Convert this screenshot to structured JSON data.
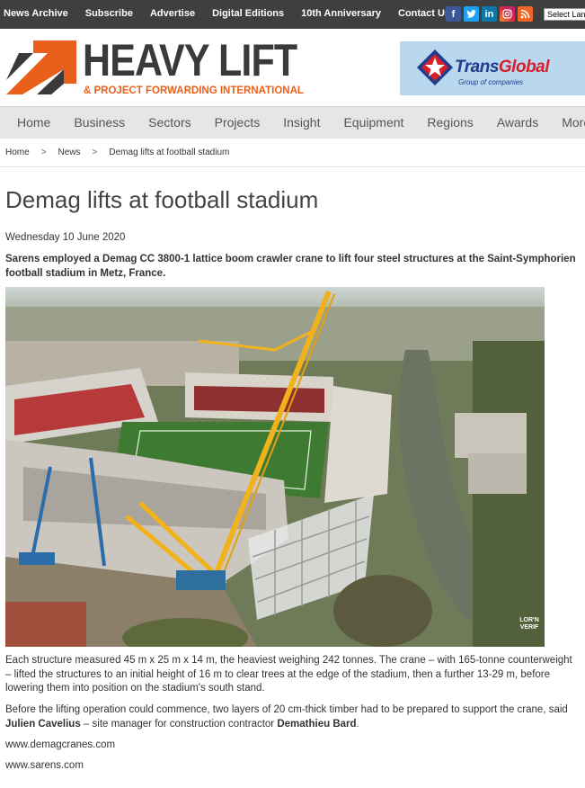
{
  "topbar": {
    "links": [
      "News Archive",
      "Subscribe",
      "Advertise",
      "Digital Editions",
      "10th Anniversary",
      "Contact Us"
    ],
    "social": [
      {
        "icon": "facebook-icon",
        "glyph": "f",
        "color": "#3b5998"
      },
      {
        "icon": "twitter-icon",
        "glyph": "t",
        "color": "#1da1f2"
      },
      {
        "icon": "linkedin-icon",
        "glyph": "in",
        "color": "#0e76a8"
      },
      {
        "icon": "instagram-icon",
        "glyph": "◎",
        "color": "#c13584"
      },
      {
        "icon": "rss-icon",
        "glyph": "◔",
        "color": "#f26522"
      }
    ],
    "language_select": "Select Language"
  },
  "header": {
    "logo_title": "HEAVY LIFT",
    "logo_subtitle": "& PROJECT FORWARDING INTERNATIONAL",
    "logo_color": "#e8601c",
    "ad": {
      "name_part1": "Trans",
      "name_part2": "Global",
      "tagline": "Group of companies"
    }
  },
  "nav": {
    "items": [
      "Home",
      "Business",
      "Sectors",
      "Projects",
      "Insight",
      "Equipment",
      "Regions",
      "Awards",
      "More"
    ]
  },
  "breadcrumb": {
    "items": [
      "Home",
      "News",
      "Demag lifts at football stadium"
    ],
    "separator": ">"
  },
  "article": {
    "title": "Demag lifts at football stadium",
    "date": "Wednesday 10 June 2020",
    "standfirst": "Sarens employed a Demag CC 3800-1 lattice boom crawler crane to lift four steel structures at the Saint-Symphorien football stadium in Metz, France.",
    "photo_credit": "LOR'N VERIF",
    "p1": "Each structure measured 45 m x 25 m x 14 m, the heaviest weighing 242 tonnes. The crane – with 165-tonne counterweight – lifted the structures to an initial height of 16 m to clear trees at the edge of the stadium, then a further 13-29 m, before lowering them into position on the stadium's south stand.",
    "p2_before": "Before the lifting operation could commence, two layers of 20 cm-thick timber had to be prepared to support the crane, said ",
    "p2_name1": "Julien Cavelius",
    "p2_middle": " – site manager for construction contractor ",
    "p2_name2": "Demathieu Bard",
    "p2_end": ".",
    "links": [
      "www.demagcranes.com",
      "www.sarens.com"
    ]
  }
}
